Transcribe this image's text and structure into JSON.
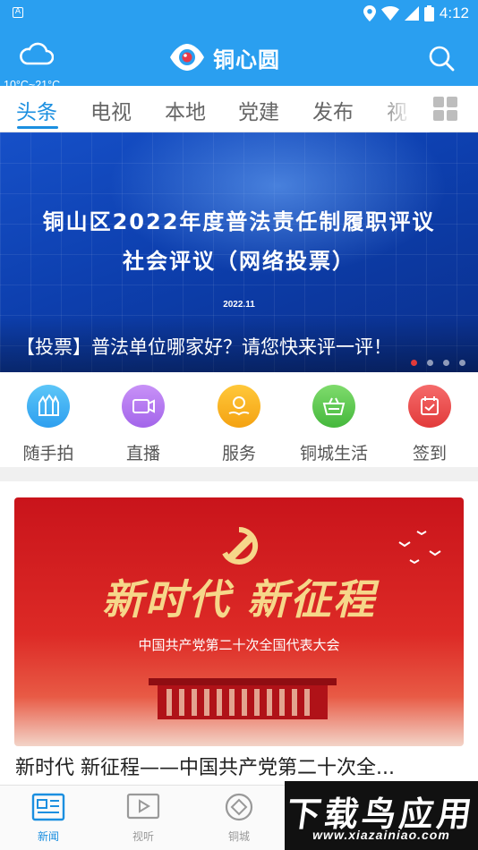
{
  "status_bar": {
    "time": "4:12",
    "left_badge": "A"
  },
  "header": {
    "weather": "10°C~21°C",
    "app_name": "铜心圆"
  },
  "tabs": [
    {
      "label": "头条",
      "active": true
    },
    {
      "label": "电视"
    },
    {
      "label": "本地"
    },
    {
      "label": "党建"
    },
    {
      "label": "发布"
    },
    {
      "label": "视"
    }
  ],
  "banner": {
    "headline_line1": "铜山区2022年度普法责任制履职评议",
    "headline_line2": "社会评议（网络投票）",
    "date": "2022.11",
    "caption": "【投票】普法单位哪家好？请您快来评一评！",
    "slides": 4,
    "active_slide": 1
  },
  "shortcuts": [
    {
      "label": "随手拍",
      "icon": "camera-icon",
      "color": "#49b6f3"
    },
    {
      "label": "直播",
      "icon": "video-icon",
      "color": "#b478ef"
    },
    {
      "label": "服务",
      "icon": "service-icon",
      "color": "#f7b21c"
    },
    {
      "label": "铜城生活",
      "icon": "basket-icon",
      "color": "#5fcb52"
    },
    {
      "label": "签到",
      "icon": "checkin-icon",
      "color": "#ee4e4e"
    }
  ],
  "news_card": {
    "image_title": "新时代 新征程",
    "image_subtitle": "中国共产党第二十次全国代表大会",
    "caption": "新时代 新征程——中国共产党第二十次全..."
  },
  "bottom_nav": [
    {
      "label": "新闻",
      "active": true
    },
    {
      "label": "视听"
    },
    {
      "label": "铜城"
    }
  ],
  "watermark": {
    "line1": "下载鸟应用",
    "line2": "www.xiazainiao.com"
  },
  "colors": {
    "primary": "#2a9ff0",
    "tab_active": "#1b8fe0"
  }
}
